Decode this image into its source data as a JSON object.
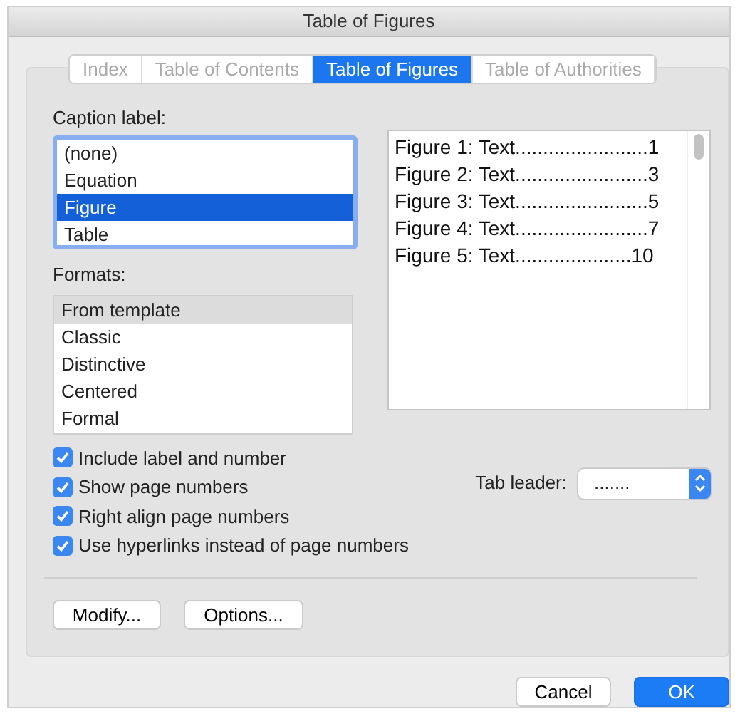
{
  "window": {
    "title": "Table of Figures"
  },
  "tabs": [
    {
      "label": "Index",
      "selected": false
    },
    {
      "label": "Table of Contents",
      "selected": false
    },
    {
      "label": "Table of Figures",
      "selected": true
    },
    {
      "label": "Table of Authorities",
      "selected": false
    }
  ],
  "caption_label": {
    "label": "Caption label:",
    "items": [
      {
        "label": "(none)",
        "selected": false
      },
      {
        "label": "Equation",
        "selected": false
      },
      {
        "label": "Figure",
        "selected": true
      },
      {
        "label": "Table",
        "selected": false
      }
    ]
  },
  "preview": {
    "entries": [
      {
        "title": "Figure 1: Text",
        "leader": "........................",
        "page": "1"
      },
      {
        "title": "Figure 2: Text",
        "leader": "........................",
        "page": "3"
      },
      {
        "title": "Figure 3: Text",
        "leader": "........................",
        "page": "5"
      },
      {
        "title": "Figure 4: Text",
        "leader": "........................",
        "page": "7"
      },
      {
        "title": "Figure 5: Text",
        "leader": ".....................",
        "page": "10"
      }
    ]
  },
  "formats": {
    "label": "Formats:",
    "items": [
      {
        "label": "From template",
        "selected": true
      },
      {
        "label": "Classic",
        "selected": false
      },
      {
        "label": "Distinctive",
        "selected": false
      },
      {
        "label": "Centered",
        "selected": false
      },
      {
        "label": "Formal",
        "selected": false
      }
    ]
  },
  "options": [
    {
      "label": "Include label and number",
      "checked": true
    },
    {
      "label": "Show page numbers",
      "checked": true
    },
    {
      "label": "Right align page numbers",
      "checked": true
    },
    {
      "label": "Use hyperlinks instead of page numbers",
      "checked": true
    }
  ],
  "tab_leader": {
    "label": "Tab leader:",
    "value": "......."
  },
  "panel_buttons": [
    "Modify...",
    "Options..."
  ],
  "dialog_buttons": [
    {
      "label": "Cancel",
      "kind": "secondary"
    },
    {
      "label": "OK",
      "kind": "default"
    }
  ]
}
